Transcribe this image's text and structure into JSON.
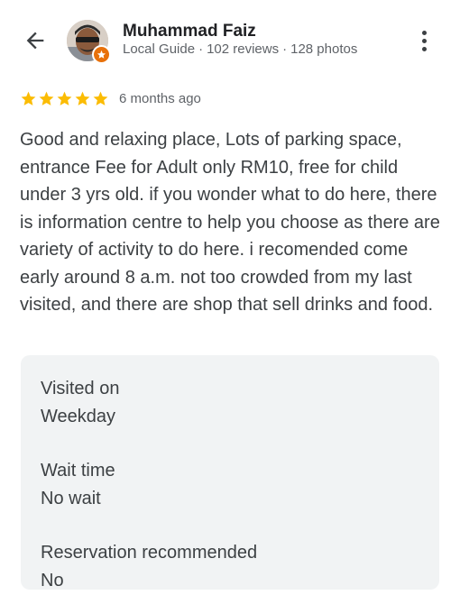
{
  "header": {
    "back_icon": "arrow-left-icon",
    "reviewer_name": "Muhammad Faiz",
    "reviewer_role": "Local Guide",
    "reviews_count": "102 reviews",
    "photos_count": "128 photos",
    "separator": "·",
    "badge_icon": "local-guide-star-icon",
    "more_icon": "more-vert-icon"
  },
  "rating": {
    "stars": 5,
    "max_stars": 5,
    "star_color": "#fbbc04",
    "time_ago": "6 months ago"
  },
  "review_text": "Good and relaxing place, Lots of parking space, entrance Fee for Adult only RM10, free for child under 3 yrs old. if you wonder what to do here, there is information centre to help you choose as there are variety of activity to do here. i recomended come early around 8 a.m. not too crowded from my last visited, and there are shop that sell drinks and food.",
  "details": [
    {
      "label": "Visited on",
      "value": "Weekday"
    },
    {
      "label": "Wait time",
      "value": "No wait"
    },
    {
      "label": "Reservation recommended",
      "value": "No"
    }
  ],
  "colors": {
    "badge": "#e8710a",
    "card_bg": "#f1f3f4"
  }
}
